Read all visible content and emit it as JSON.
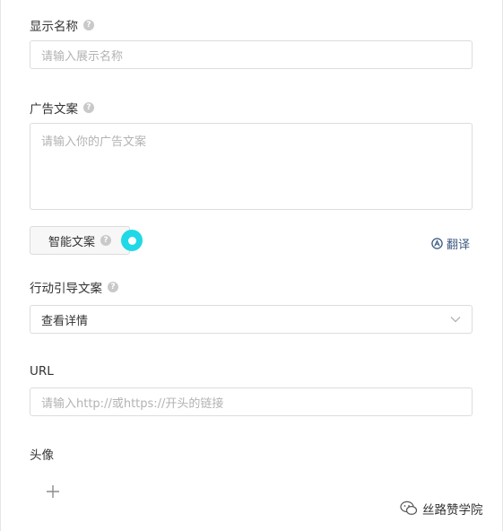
{
  "display_name": {
    "label": "显示名称",
    "placeholder": "请输入展示名称"
  },
  "ad_copy": {
    "label": "广告文案",
    "placeholder": "请输入你的广告文案"
  },
  "smart_copy": {
    "button_label": "智能文案"
  },
  "translate": {
    "label": "翻译"
  },
  "cta": {
    "label": "行动引导文案",
    "selected": "查看详情"
  },
  "url": {
    "label": "URL",
    "placeholder": "请输入http://或https://开头的链接"
  },
  "avatar": {
    "label": "头像"
  },
  "watermark": {
    "text": "丝路赞学院"
  },
  "help_glyph": "?",
  "colors": {
    "accent_cursor": "#1fd9e6",
    "link": "#3c5a80",
    "border": "#dcdcdc"
  }
}
